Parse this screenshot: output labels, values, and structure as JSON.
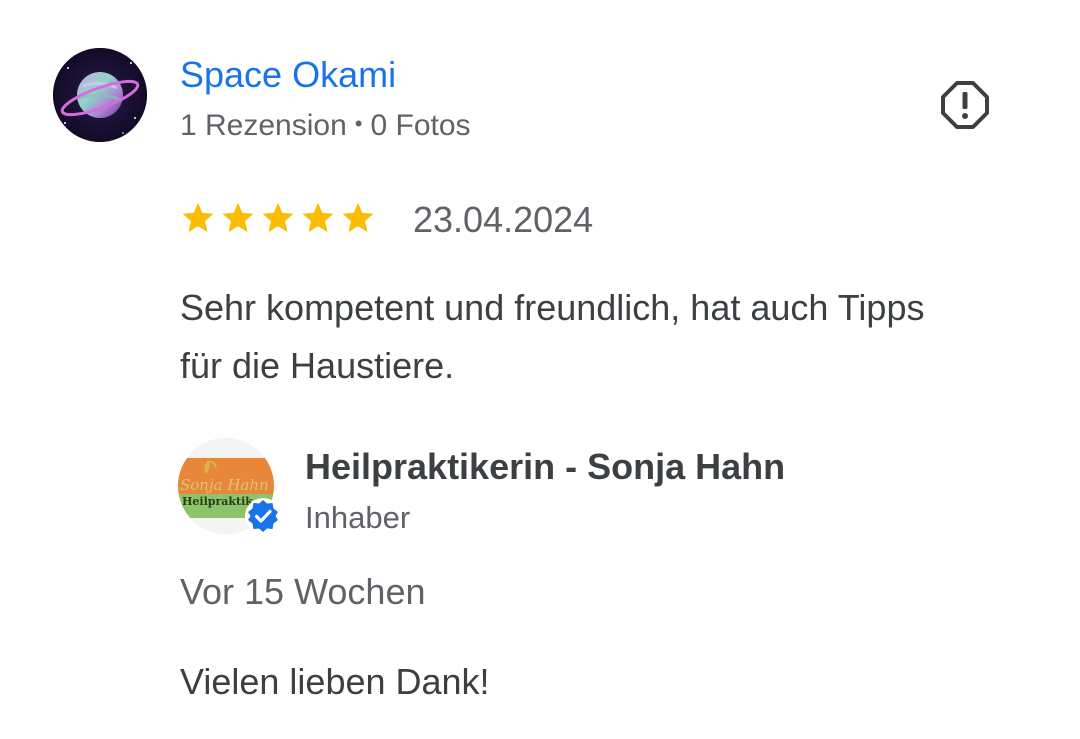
{
  "review": {
    "author": {
      "name": "Space Okami",
      "review_count": "1 Rezension",
      "separator": "•",
      "photo_count": "0 Fotos",
      "avatar_icon": "planet-avatar"
    },
    "report_icon": "report-icon",
    "rating": {
      "stars": 5,
      "max": 5,
      "star_color": "#fbbc04"
    },
    "date": "23.04.2024",
    "text": "Sehr kompetent und freundlich, hat auch Tipps für die Haustiere."
  },
  "owner_reply": {
    "name": "Heilpraktikerin - Sonja Hahn",
    "role": "Inhaber",
    "logo_text": {
      "line1": "Sonja Hahn",
      "line2": "Heilpraktik"
    },
    "verified_icon": "verified-check-icon",
    "time": "Vor 15 Wochen",
    "text": "Vielen lieben Dank!"
  },
  "colors": {
    "link": "#1a73e8",
    "text_primary": "#3c4043",
    "text_secondary": "#5f6368",
    "verified": "#1a73e8"
  }
}
